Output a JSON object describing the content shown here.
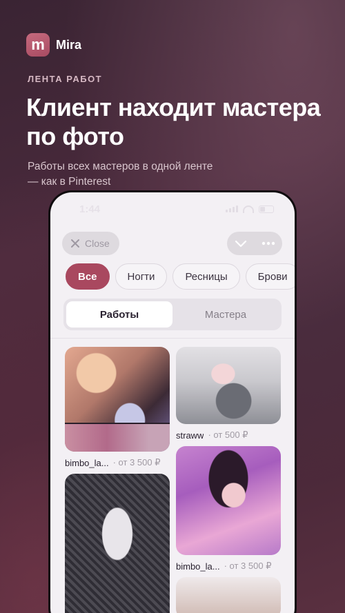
{
  "brand": {
    "logo_letter": "m",
    "name": "Mira"
  },
  "promo": {
    "eyebrow": "ЛЕНТА РАБОТ",
    "headline": "Клиент находит мастера по фото",
    "subtitle": "Работы всех мастеров в одной ленте — как в Pinterest"
  },
  "status_bar": {
    "time": "1:44"
  },
  "topbar": {
    "close_label": "Close"
  },
  "chips": [
    "Все",
    "Ногти",
    "Ресницы",
    "Брови"
  ],
  "segment": {
    "works": "Работы",
    "masters": "Мастера"
  },
  "feed": {
    "left": [
      {
        "name": "bimbo_la...",
        "price": "· от 3 500 ₽"
      },
      {
        "name": "",
        "price": ""
      }
    ],
    "right": [
      {
        "name": "straww",
        "price": "· от 500 ₽"
      },
      {
        "name": "bimbo_la...",
        "price": "· от 3 500 ₽"
      }
    ]
  },
  "colors": {
    "accent": "#a9485f",
    "background": "#3a2433",
    "screen": "#f3f0f4"
  }
}
